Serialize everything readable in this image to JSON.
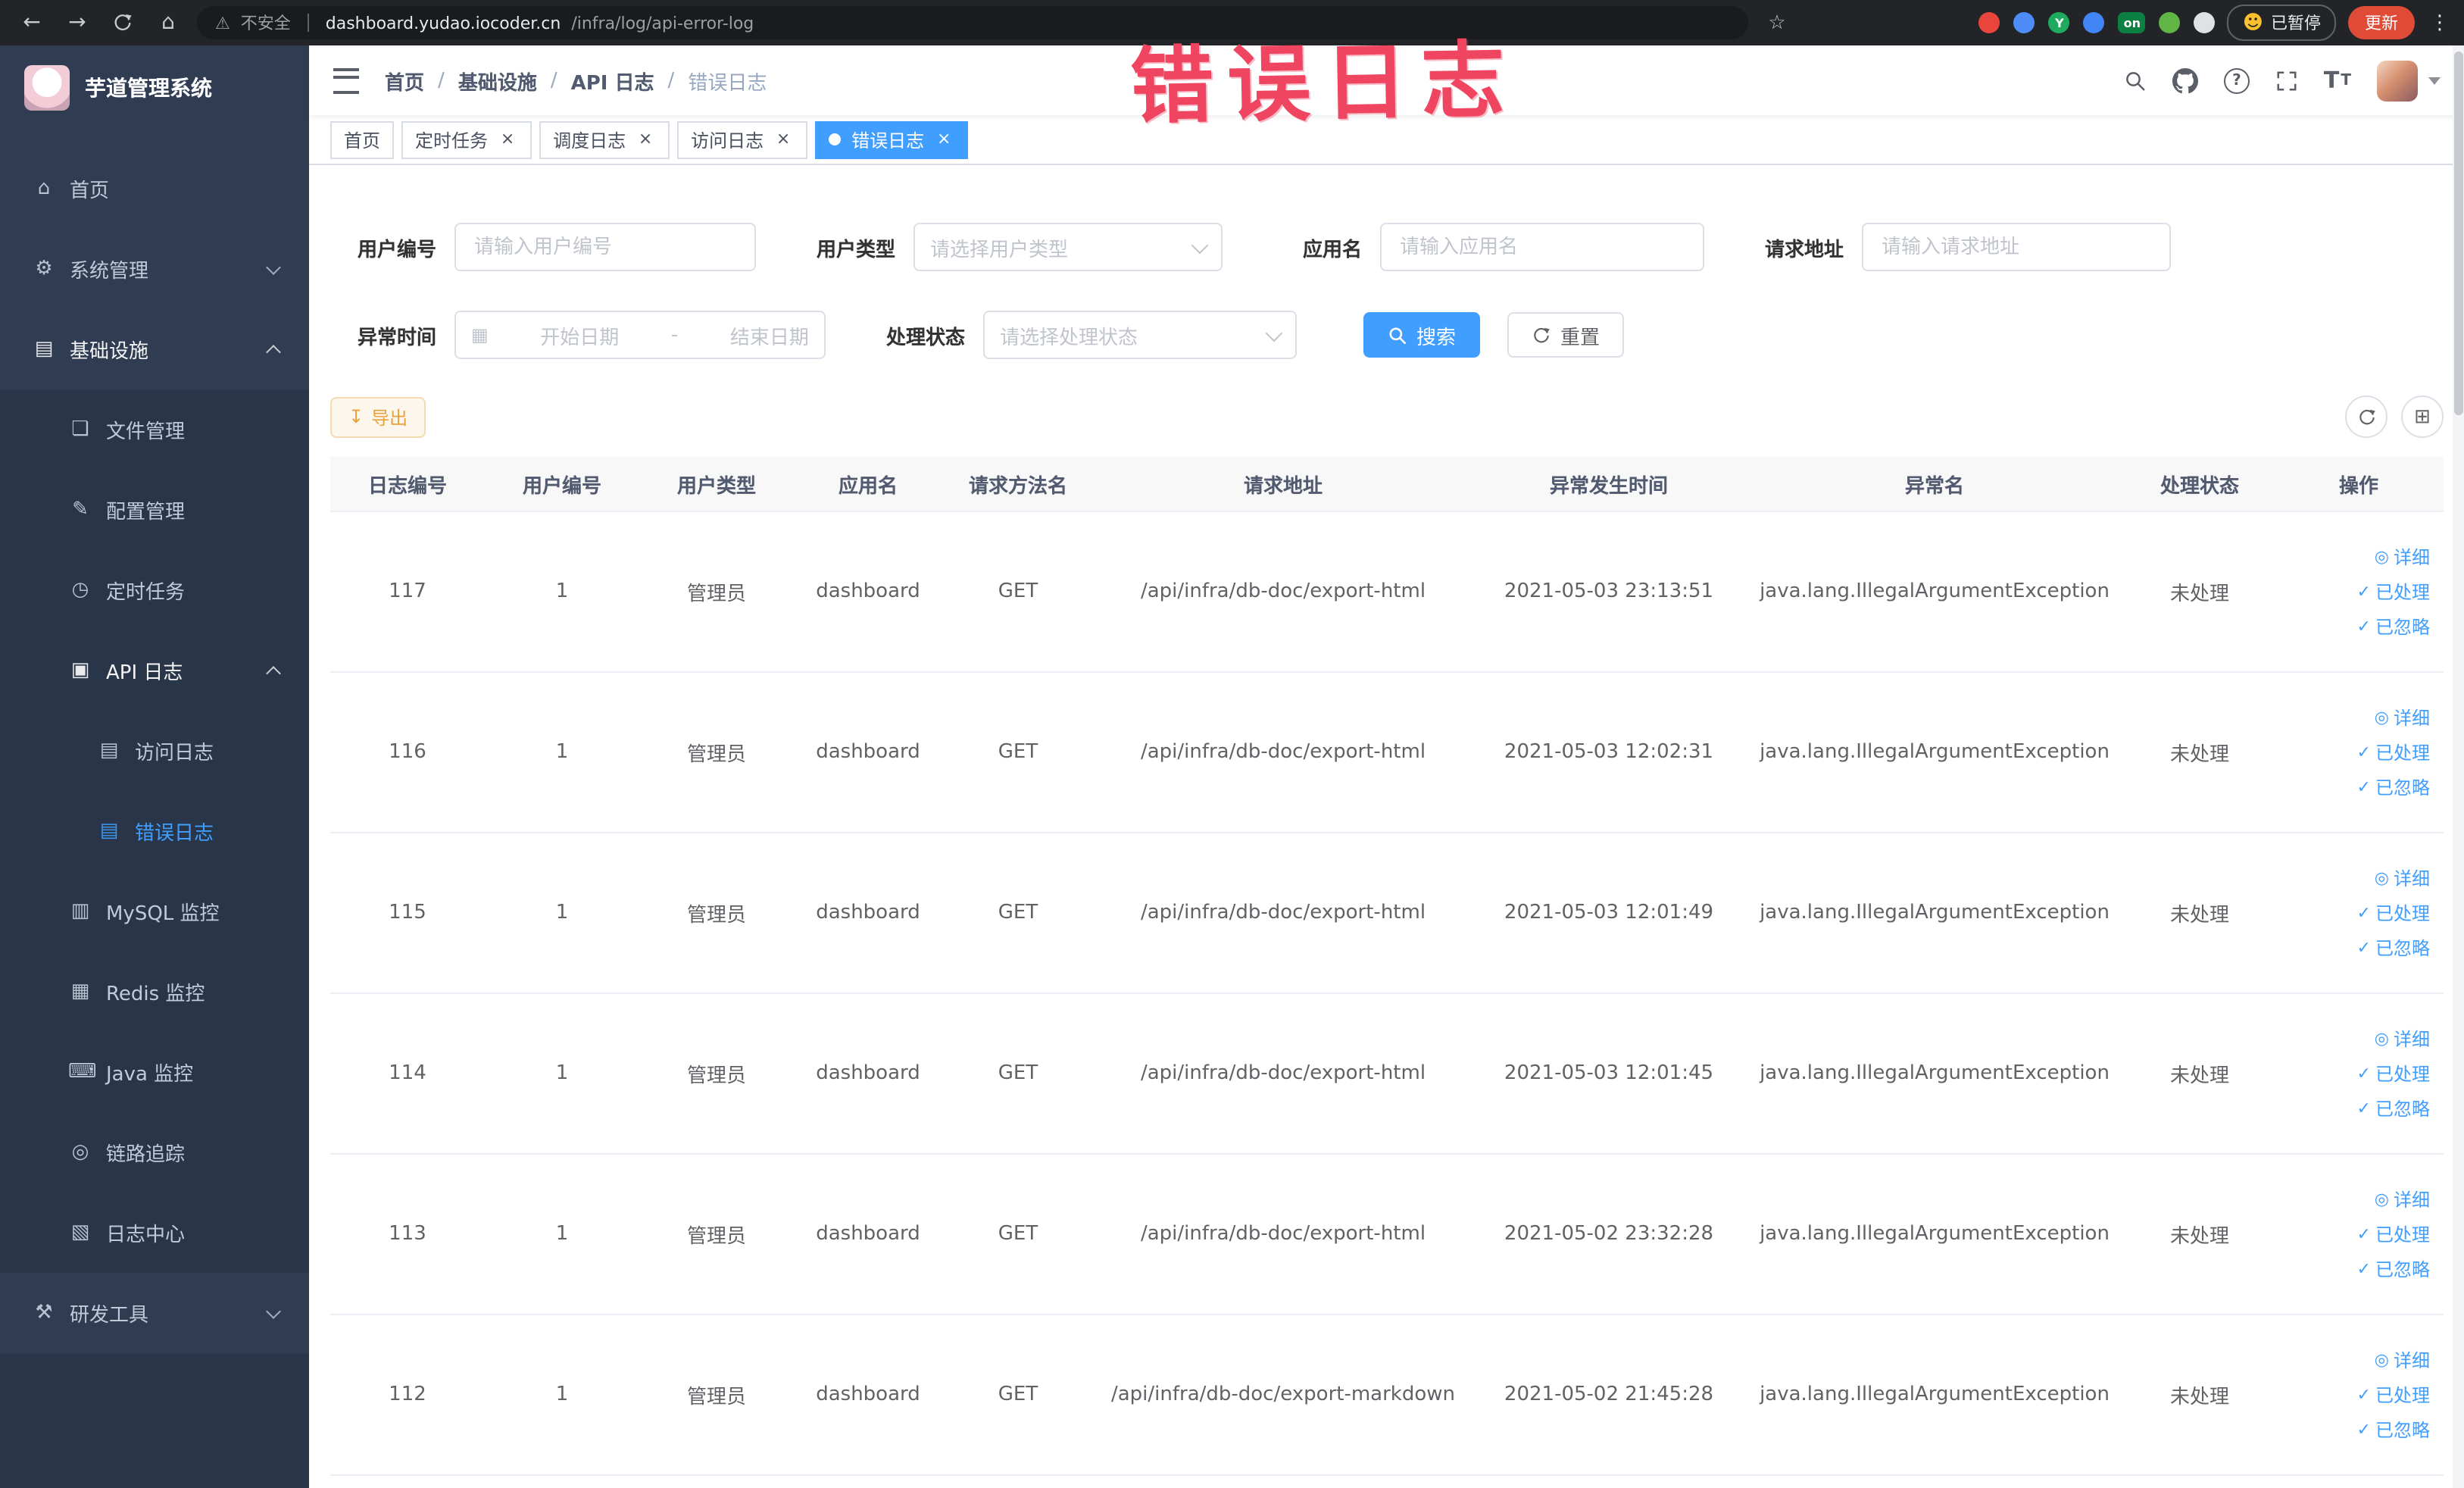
{
  "browser": {
    "security_chip": "不安全",
    "url_host": "dashboard.yudao.iocoder.cn",
    "url_path": "/infra/log/api-error-log",
    "paused_badge": "已暂停",
    "update_button": "更新",
    "extensions": [
      {
        "key": "ext-red",
        "color": "#e8453c",
        "shape": "circle",
        "text": ""
      },
      {
        "key": "ext-blue",
        "color": "#4e8cf7",
        "shape": "circle",
        "text": ""
      },
      {
        "key": "ext-green-y",
        "color": "#1fab5e",
        "shape": "circle",
        "text": "Y"
      },
      {
        "key": "ext-grid",
        "color": "#4285f4",
        "shape": "circle",
        "text": ""
      },
      {
        "key": "ext-on",
        "color": "#0b8043",
        "shape": "pill",
        "text": "on"
      },
      {
        "key": "ext-leaf",
        "color": "#61b544",
        "shape": "circle",
        "text": ""
      },
      {
        "key": "ext-pin",
        "color": "#dfe1e5",
        "shape": "circle",
        "text": ""
      }
    ]
  },
  "annotation": {
    "text": "错误日志",
    "color": "#ef4560"
  },
  "sidebar": {
    "logo_title": "芋道管理系统",
    "items": [
      {
        "key": "home",
        "label": "首页",
        "level": 0,
        "icon": "home"
      },
      {
        "key": "system-mgmt",
        "label": "系统管理",
        "level": 0,
        "icon": "gear",
        "chevron": "down"
      },
      {
        "key": "infrastructure",
        "label": "基础设施",
        "level": 0,
        "icon": "infra",
        "chevron": "up",
        "open": true
      },
      {
        "key": "file-mgmt",
        "label": "文件管理",
        "level": 1,
        "icon": "file"
      },
      {
        "key": "config-mgmt",
        "label": "配置管理",
        "level": 1,
        "icon": "config"
      },
      {
        "key": "scheduled-tasks",
        "label": "定时任务",
        "level": 1,
        "icon": "timer"
      },
      {
        "key": "api-log",
        "label": "API 日志",
        "level": 1,
        "icon": "api_log",
        "chevron": "up",
        "open": true
      },
      {
        "key": "access-log",
        "label": "访问日志",
        "level": 2,
        "icon": "doc"
      },
      {
        "key": "error-log",
        "label": "错误日志",
        "level": 2,
        "icon": "doc",
        "active": true
      },
      {
        "key": "mysql-monitor",
        "label": "MySQL 监控",
        "level": 1,
        "icon": "mysql"
      },
      {
        "key": "redis-monitor",
        "label": "Redis 监控",
        "level": 1,
        "icon": "redis"
      },
      {
        "key": "java-monitor",
        "label": "Java 监控",
        "level": 1,
        "icon": "java"
      },
      {
        "key": "tracing",
        "label": "链路追踪",
        "level": 1,
        "icon": "trace"
      },
      {
        "key": "log-center",
        "label": "日志中心",
        "level": 1,
        "icon": "log_center"
      },
      {
        "key": "dev-tools",
        "label": "研发工具",
        "level": 0,
        "icon": "tools",
        "chevron": "down"
      }
    ]
  },
  "header": {
    "breadcrumb": [
      "首页",
      "基础设施",
      "API 日志",
      "错误日志"
    ],
    "separator": "/"
  },
  "tabs": [
    {
      "key": "home",
      "label": "首页",
      "closable": false,
      "active": false
    },
    {
      "key": "scheduled-tasks",
      "label": "定时任务",
      "closable": true,
      "active": false
    },
    {
      "key": "job-log",
      "label": "调度日志",
      "closable": true,
      "active": false
    },
    {
      "key": "access-log",
      "label": "访问日志",
      "closable": true,
      "active": false
    },
    {
      "key": "error-log",
      "label": "错误日志",
      "closable": true,
      "active": true
    }
  ],
  "filters": {
    "user_id": {
      "label": "用户编号",
      "placeholder": "请输入用户编号"
    },
    "user_type": {
      "label": "用户类型",
      "placeholder": "请选择用户类型"
    },
    "app_name": {
      "label": "应用名",
      "placeholder": "请输入应用名"
    },
    "request_url": {
      "label": "请求地址",
      "placeholder": "请输入请求地址"
    },
    "exception_time": {
      "label": "异常时间",
      "start_placeholder": "开始日期",
      "separator": "-",
      "end_placeholder": "结束日期"
    },
    "process_status": {
      "label": "处理状态",
      "placeholder": "请选择处理状态"
    },
    "search_button": "搜索",
    "reset_button": "重置"
  },
  "toolbar": {
    "export_button": "导出"
  },
  "table": {
    "columns": [
      "日志编号",
      "用户编号",
      "用户类型",
      "应用名",
      "请求方法名",
      "请求地址",
      "异常发生时间",
      "异常名",
      "处理状态",
      "操作"
    ],
    "actions": [
      {
        "key": "detail",
        "label": "详细",
        "icon": "eye"
      },
      {
        "key": "processed",
        "label": "已处理",
        "icon": "check"
      },
      {
        "key": "ignore",
        "label": "已忽略",
        "icon": "check"
      }
    ],
    "rows": [
      {
        "log_id": "117",
        "user_id": "1",
        "user_type": "管理员",
        "app": "dashboard",
        "method": "GET",
        "url": "/api/infra/db-doc/export-html",
        "time": "2021-05-03 23:13:51",
        "exception": "java.lang.IllegalArgumentException",
        "status": "未处理"
      },
      {
        "log_id": "116",
        "user_id": "1",
        "user_type": "管理员",
        "app": "dashboard",
        "method": "GET",
        "url": "/api/infra/db-doc/export-html",
        "time": "2021-05-03 12:02:31",
        "exception": "java.lang.IllegalArgumentException",
        "status": "未处理"
      },
      {
        "log_id": "115",
        "user_id": "1",
        "user_type": "管理员",
        "app": "dashboard",
        "method": "GET",
        "url": "/api/infra/db-doc/export-html",
        "time": "2021-05-03 12:01:49",
        "exception": "java.lang.IllegalArgumentException",
        "status": "未处理"
      },
      {
        "log_id": "114",
        "user_id": "1",
        "user_type": "管理员",
        "app": "dashboard",
        "method": "GET",
        "url": "/api/infra/db-doc/export-html",
        "time": "2021-05-03 12:01:45",
        "exception": "java.lang.IllegalArgumentException",
        "status": "未处理"
      },
      {
        "log_id": "113",
        "user_id": "1",
        "user_type": "管理员",
        "app": "dashboard",
        "method": "GET",
        "url": "/api/infra/db-doc/export-html",
        "time": "2021-05-02 23:32:28",
        "exception": "java.lang.IllegalArgumentException",
        "status": "未处理"
      },
      {
        "log_id": "112",
        "user_id": "1",
        "user_type": "管理员",
        "app": "dashboard",
        "method": "GET",
        "url": "/api/infra/db-doc/export-markdown",
        "time": "2021-05-02 21:45:28",
        "exception": "java.lang.IllegalArgumentException",
        "status": "未处理"
      }
    ]
  },
  "icons": {
    "home": "⌂",
    "gear": "⚙",
    "infra": "▤",
    "file": "❏",
    "config": "✎",
    "timer": "◷",
    "api_log": "▣",
    "doc": "▤",
    "mysql": "▥",
    "redis": "▦",
    "java": "⌨",
    "trace": "◎",
    "log_center": "▧",
    "tools": "⚒",
    "back": "←",
    "forward": "→",
    "warning": "⚠",
    "star": "☆",
    "kebab": "⋮",
    "emoji_paused": "☻",
    "close": "×",
    "download": "↧",
    "grid": "⊞",
    "calendar": "▦",
    "help": "?",
    "font_size": "T",
    "eye": "◎",
    "check": "✓"
  }
}
